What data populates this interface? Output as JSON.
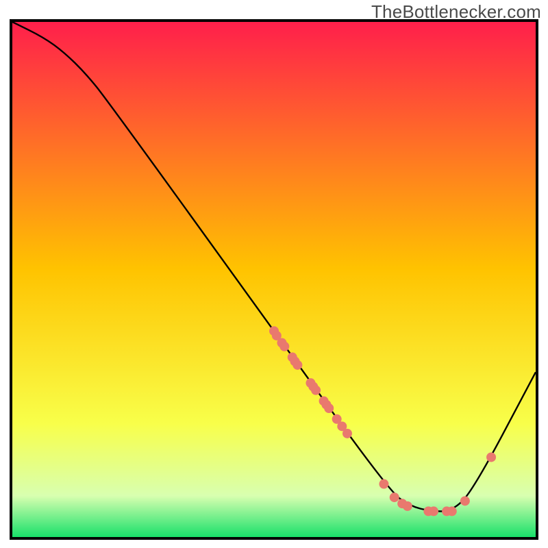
{
  "watermark": {
    "text": "TheBottlenecker.com"
  },
  "chart_data": {
    "type": "line",
    "title": "",
    "xlabel": "",
    "ylabel": "",
    "xlim": [
      0,
      100
    ],
    "ylim": [
      0,
      100
    ],
    "gradient": {
      "top_color": "#ff1f4b",
      "mid_upper_color": "#ffc300",
      "mid_lower_color": "#f8ff4a",
      "band_color": "#d8ffb0",
      "bottom_color": "#18e06a"
    },
    "series": [
      {
        "name": "bottleneck-curve",
        "x": [
          0,
          6,
          10,
          14,
          18,
          50,
          72,
          76,
          80,
          84,
          88,
          100
        ],
        "y": [
          100,
          97,
          94,
          90,
          85,
          40,
          9,
          6,
          5,
          5,
          9,
          32
        ]
      }
    ],
    "points": {
      "name": "gpu-points",
      "color": "#e9796e",
      "radius": 7,
      "data": [
        {
          "x": 50.0,
          "y": 40.0
        },
        {
          "x": 50.5,
          "y": 39.1
        },
        {
          "x": 51.5,
          "y": 37.7
        },
        {
          "x": 52.0,
          "y": 37.0
        },
        {
          "x": 53.5,
          "y": 34.9
        },
        {
          "x": 54.0,
          "y": 34.1
        },
        {
          "x": 54.5,
          "y": 33.4
        },
        {
          "x": 57.0,
          "y": 29.9
        },
        {
          "x": 57.5,
          "y": 29.2
        },
        {
          "x": 58.0,
          "y": 28.5
        },
        {
          "x": 59.5,
          "y": 26.4
        },
        {
          "x": 60.0,
          "y": 25.7
        },
        {
          "x": 60.5,
          "y": 25.0
        },
        {
          "x": 62.0,
          "y": 22.9
        },
        {
          "x": 63.0,
          "y": 21.5
        },
        {
          "x": 64.0,
          "y": 20.1
        },
        {
          "x": 71.0,
          "y": 10.3
        },
        {
          "x": 73.0,
          "y": 7.7
        },
        {
          "x": 74.5,
          "y": 6.5
        },
        {
          "x": 75.5,
          "y": 6.0
        },
        {
          "x": 79.5,
          "y": 5.0
        },
        {
          "x": 80.5,
          "y": 5.0
        },
        {
          "x": 83.0,
          "y": 5.0
        },
        {
          "x": 84.0,
          "y": 5.0
        },
        {
          "x": 86.5,
          "y": 7.0
        },
        {
          "x": 91.5,
          "y": 15.5
        }
      ]
    }
  }
}
